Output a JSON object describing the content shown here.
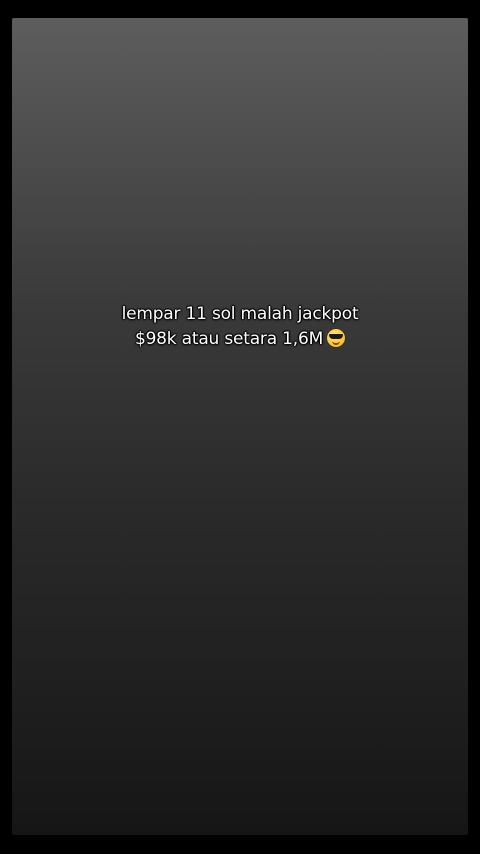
{
  "caption": {
    "line1": "lempar 11 sol malah jackpot",
    "line2": "$98k atau setara 1,6M",
    "emoji_icon": "smiling-face-with-sunglasses-icon"
  },
  "colors": {
    "background": "#000000",
    "panel_top": "#5d5d5d",
    "panel_bottom": "#161616",
    "text": "#ffffff"
  }
}
